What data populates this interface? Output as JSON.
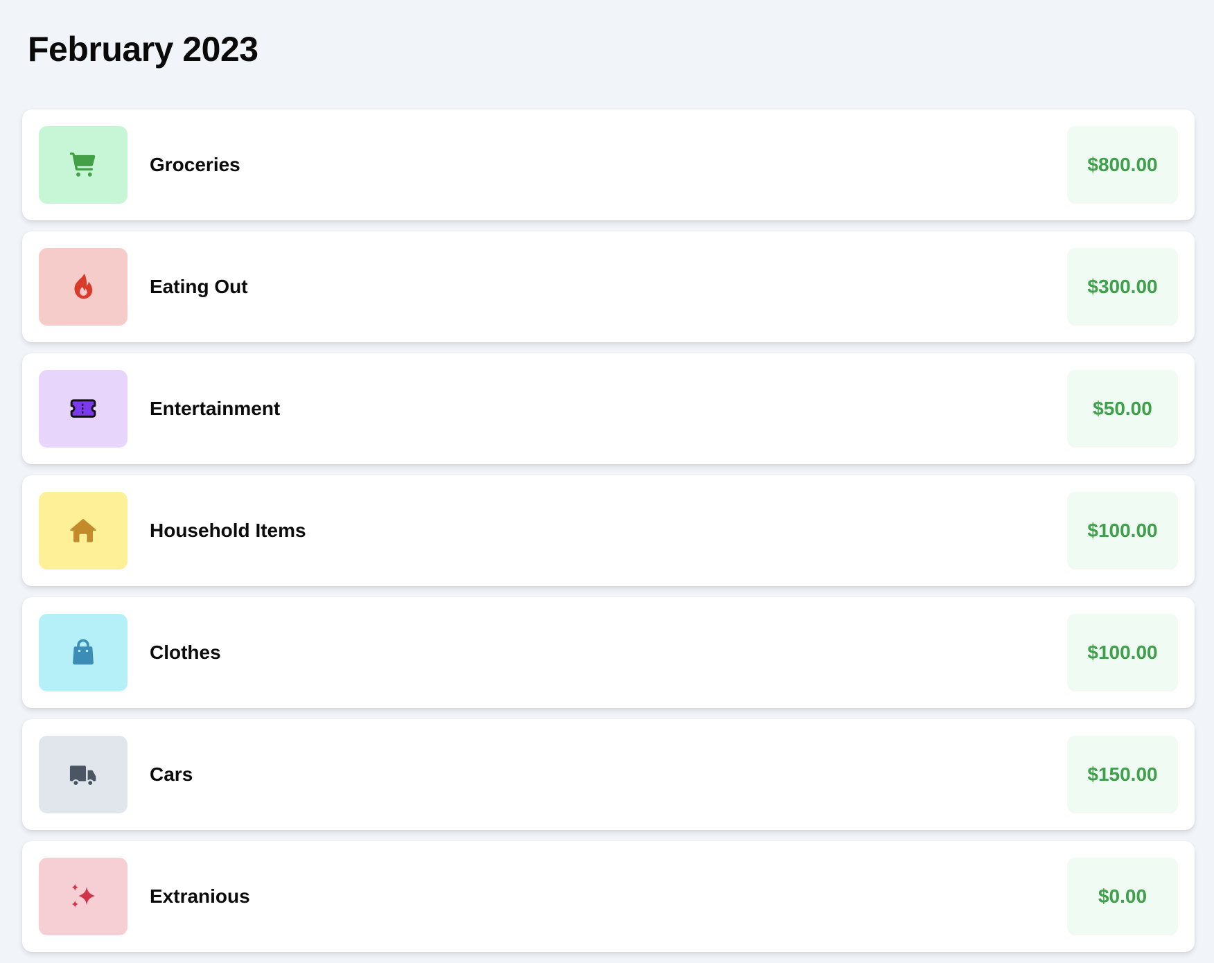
{
  "page": {
    "title": "February 2023"
  },
  "colors": {
    "background": "#f1f5f9",
    "card": "#ffffff",
    "amount_text": "#3fa04a",
    "amount_bg": "#f0fbf3"
  },
  "categories": [
    {
      "label": "Groceries",
      "amount": "$800.00",
      "icon": "shopping-cart-icon",
      "icon_bg": "#c6f6d5",
      "icon_color": "#43a047"
    },
    {
      "label": "Eating Out",
      "amount": "$300.00",
      "icon": "fire-icon",
      "icon_bg": "#f6cccb",
      "icon_color": "#d93b2b"
    },
    {
      "label": "Entertainment",
      "amount": "$50.00",
      "icon": "ticket-icon",
      "icon_bg": "#e8d5fb",
      "icon_color": "#7c3aed"
    },
    {
      "label": "Household Items",
      "amount": "$100.00",
      "icon": "home-icon",
      "icon_bg": "#fdf097",
      "icon_color": "#c28a2a"
    },
    {
      "label": "Clothes",
      "amount": "$100.00",
      "icon": "shopping-bag-icon",
      "icon_bg": "#b5eff8",
      "icon_color": "#3b8db5"
    },
    {
      "label": "Cars",
      "amount": "$150.00",
      "icon": "truck-icon",
      "icon_bg": "#e1e6ed",
      "icon_color": "#4b5563"
    },
    {
      "label": "Extranious",
      "amount": "$0.00",
      "icon": "sparkles-icon",
      "icon_bg": "#f6cfd5",
      "icon_color": "#d2324a"
    }
  ]
}
